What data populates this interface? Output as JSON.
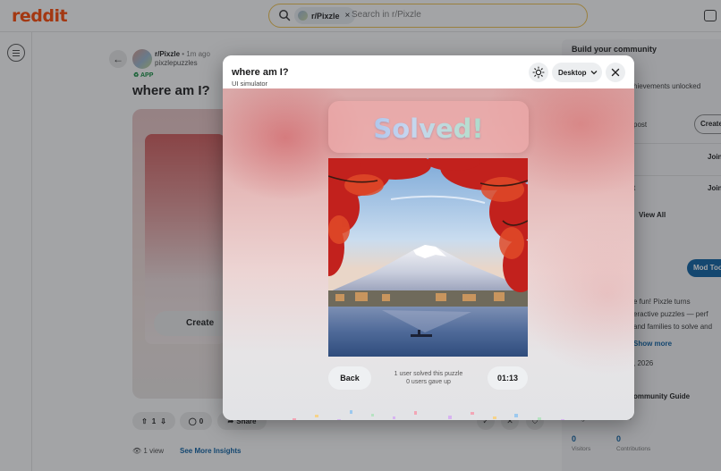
{
  "header": {
    "logo": "reddit",
    "search_chip": "r/Pixzle",
    "search_chip_close": "×",
    "search_placeholder": "Search in r/Pixzle"
  },
  "post": {
    "subreddit": "r/Pixzle",
    "time": "• 1m ago",
    "author": "pixzlepuzzles",
    "badge": "APP",
    "title": "where am I?",
    "create_label": "Create",
    "votes": "1",
    "comments": "0",
    "share_label": "Share",
    "views": "1 view",
    "insights_link": "See More Insights"
  },
  "sidebar": {
    "title": "Build your community",
    "achievements": "hievements unlocked",
    "post_text": "post",
    "create_label": "Create",
    "join_labels": [
      "Join",
      "Join"
    ],
    "row_suffix": "t",
    "view_all": "View All",
    "mod_tools": "Mod Too",
    "desc_lines": [
      "e fun! Pixzle turns",
      "eractive puzzles — perf",
      "and families to solve and"
    ],
    "show_more": "Show more",
    "date": ", 2026",
    "guide": "ommunity Guide",
    "insights": "Insights · Past week ›",
    "visitors_value": "0",
    "visitors_label": "Visitors",
    "contributions_value": "0",
    "contributions_label": "Contributions"
  },
  "modal": {
    "title": "where am I?",
    "subtitle": "UI simulator",
    "device_label": "Desktop",
    "solved_text": "Solved!",
    "back_label": "Back",
    "solved_count_text": "1 user solved this puzzle",
    "gave_up_text": "0 users gave up",
    "timer": "01:13"
  },
  "icons": {
    "search": "search-icon",
    "chip_avatar": "subreddit-avatar-icon",
    "chat": "chat-icon",
    "menu": "menu-icon",
    "back": "back-arrow-icon",
    "upvote": "upvote-icon",
    "downvote": "downvote-icon",
    "comment": "comment-icon",
    "share": "share-icon",
    "theme": "sun-icon",
    "device_dropdown": "chevron-down-icon",
    "close": "close-icon",
    "eye": "eye-icon"
  },
  "colors": {
    "brand": "#ff4500",
    "link": "#0a5fa3",
    "search_border": "#f0c14b",
    "solved_card": "#ecaaaa",
    "modal_bg_top": "#d9a7a7"
  }
}
